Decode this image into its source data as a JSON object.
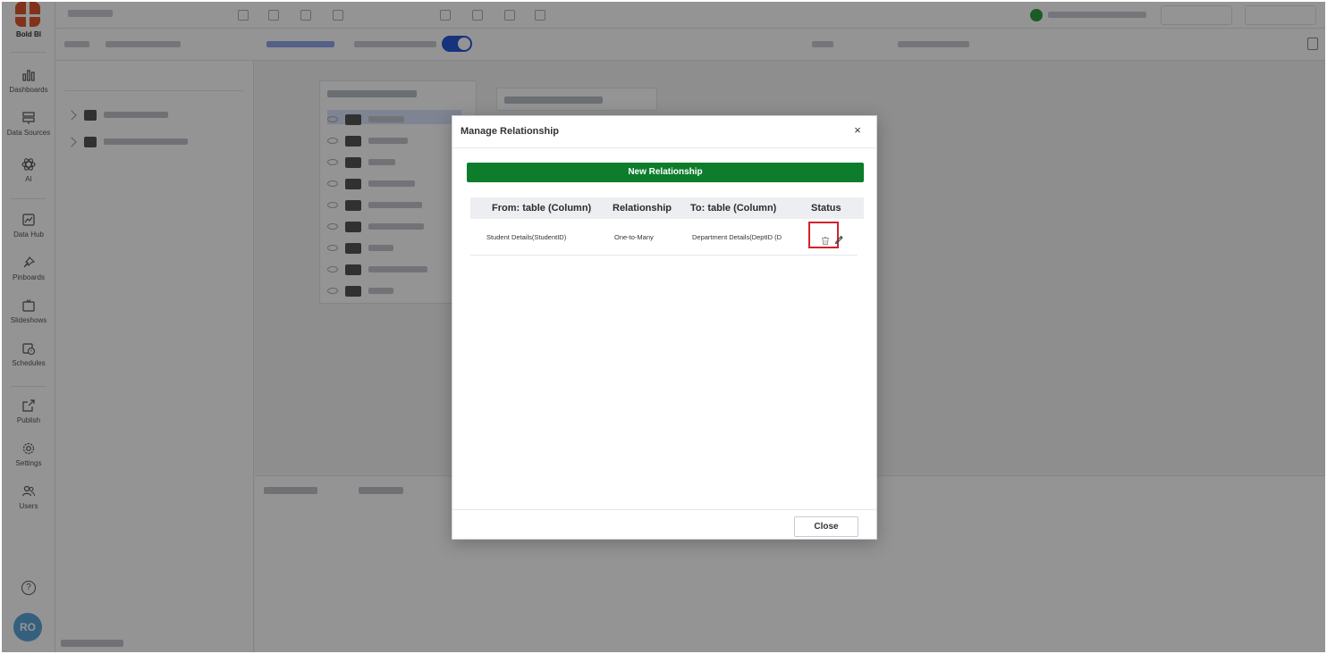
{
  "nav": {
    "brand": "Bold BI",
    "items": [
      {
        "label": "Dashboards",
        "icon": "dashboards-icon"
      },
      {
        "label": "Data Sources",
        "icon": "data-sources-icon"
      },
      {
        "label": "AI",
        "icon": "ai-icon"
      },
      {
        "label": "Data Hub",
        "icon": "data-hub-icon"
      },
      {
        "label": "Pinboards",
        "icon": "pin-icon"
      },
      {
        "label": "Slideshows",
        "icon": "slideshow-icon"
      },
      {
        "label": "Schedules",
        "icon": "schedule-icon"
      },
      {
        "label": "Publish",
        "icon": "publish-icon"
      },
      {
        "label": "Settings",
        "icon": "gear-icon"
      },
      {
        "label": "Users",
        "icon": "users-icon"
      }
    ],
    "help_glyph": "?",
    "avatar_initials": "RO"
  },
  "modal": {
    "title": "Manage Relationship",
    "close_glyph": "×",
    "new_button_label": "New Relationship",
    "columns": [
      "From: table (Column)",
      "Relationship",
      "To: table (Column)",
      "Status"
    ],
    "rows": [
      {
        "from": "Student Details(StudentID)",
        "relationship": "One-to-Many",
        "to": "Department Details(DeptID (D"
      }
    ],
    "close_button_label": "Close"
  },
  "colors": {
    "primary_green": "#0d7d2c",
    "highlight_red": "#d2232a",
    "accent_blue": "#2658d6",
    "brand_orange": "#e0572f"
  }
}
